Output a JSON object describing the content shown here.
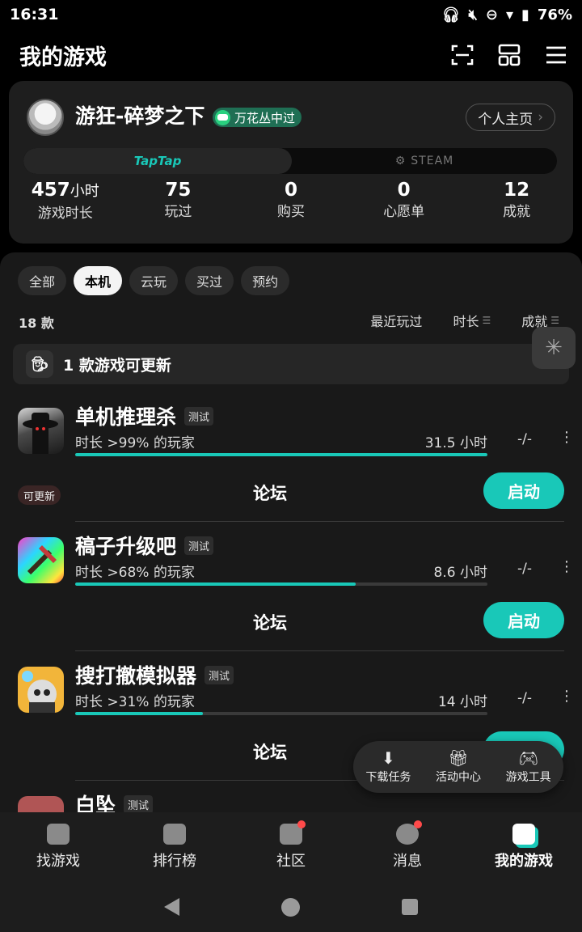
{
  "status": {
    "time": "16:31",
    "battery": "76%"
  },
  "header": {
    "title": "我的游戏"
  },
  "profile": {
    "name": "游狂-碎梦之下",
    "badge": "万花丛中过",
    "home_button": "个人主页",
    "platforms": {
      "taptap": "TapTap",
      "steam": "STEAM"
    },
    "stats": [
      {
        "value": "457",
        "unit": "小时",
        "label": "游戏时长"
      },
      {
        "value": "75",
        "unit": "",
        "label": "玩过"
      },
      {
        "value": "0",
        "unit": "",
        "label": "购买"
      },
      {
        "value": "0",
        "unit": "",
        "label": "心愿单"
      },
      {
        "value": "12",
        "unit": "",
        "label": "成就"
      }
    ]
  },
  "filters": [
    {
      "label": "全部",
      "active": false
    },
    {
      "label": "本机",
      "active": true
    },
    {
      "label": "云玩",
      "active": false
    },
    {
      "label": "买过",
      "active": false
    },
    {
      "label": "预约",
      "active": false
    }
  ],
  "list": {
    "count": "18 款",
    "sorts": [
      "最近玩过",
      "时长",
      "成就"
    ],
    "update_banner": "1 款游戏可更新"
  },
  "games": [
    {
      "title": "单机推理杀",
      "tag": "测试",
      "rank": "时长 >99% 的玩家",
      "hours": "31.5 小时",
      "achievement": "-/-",
      "progress": 1.0,
      "update": "可更新",
      "forum": "论坛",
      "launch": "启动"
    },
    {
      "title": "稿子升级吧",
      "tag": "测试",
      "rank": "时长 >68% 的玩家",
      "hours": "8.6 小时",
      "achievement": "-/-",
      "progress": 0.68,
      "update": "",
      "forum": "论坛",
      "launch": "启动"
    },
    {
      "title": "搜打撤模拟器",
      "tag": "测试",
      "rank": "时长 >31% 的玩家",
      "hours": "14 小时",
      "achievement": "-/-",
      "progress": 0.31,
      "update": "",
      "forum": "论坛",
      "launch": "启动"
    },
    {
      "title": "白坠",
      "tag": "测试"
    }
  ],
  "tools": [
    {
      "label": "下载任务",
      "icon": "download-icon"
    },
    {
      "label": "活动中心",
      "icon": "gift-icon"
    },
    {
      "label": "游戏工具",
      "icon": "gamepad-icon"
    }
  ],
  "nav": [
    {
      "label": "找游戏",
      "dot": false,
      "active": false
    },
    {
      "label": "排行榜",
      "dot": false,
      "active": false
    },
    {
      "label": "社区",
      "dot": true,
      "active": false
    },
    {
      "label": "消息",
      "dot": true,
      "active": false
    },
    {
      "label": "我的游戏",
      "dot": false,
      "active": true
    }
  ],
  "colors": {
    "accent": "#19c8b8",
    "background": "#000000",
    "card": "#1e1e1e",
    "notify": "#ff4a4a"
  }
}
